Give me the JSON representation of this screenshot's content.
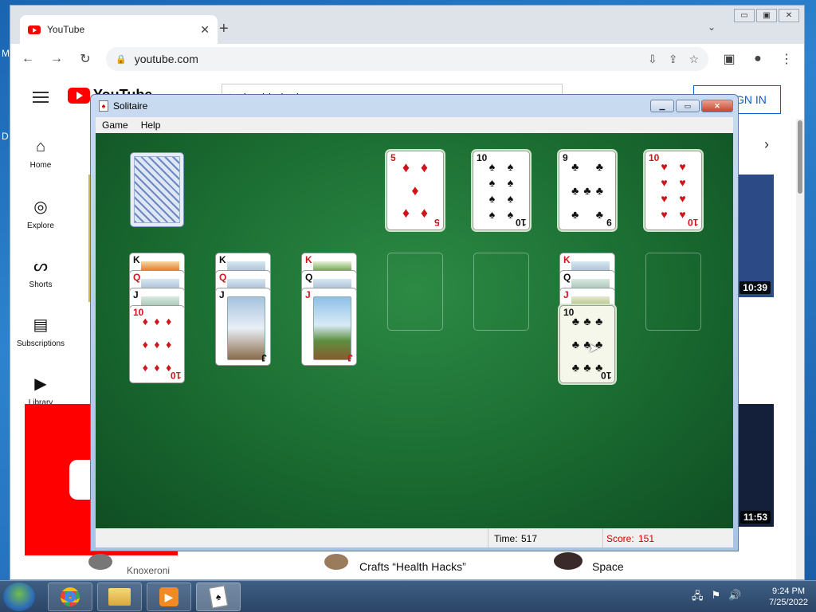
{
  "desktop": {
    "edge_letters": [
      "M",
      "D"
    ]
  },
  "browser": {
    "tab_title": "YouTube",
    "tab_close": "✕",
    "new_tab": "+",
    "tabs_menu": "⌄",
    "window_buttons": [
      "▭",
      "▣",
      "✕"
    ],
    "nav": {
      "back": "←",
      "forward": "→",
      "reload": "↻",
      "lock": "🔒"
    },
    "url": "youtube.com",
    "omnibox_icons": [
      "⇩",
      "⇪",
      "☆",
      "▣",
      "●",
      "⋮"
    ]
  },
  "youtube": {
    "logo_text": "YouTube",
    "search_value": "technoblade dog",
    "sign_in_label": "SIGN IN",
    "sidebar": [
      {
        "label": "Home",
        "icon": "⌂"
      },
      {
        "label": "Explore",
        "icon": "◎"
      },
      {
        "label": "Shorts",
        "icon": "ᔕ"
      },
      {
        "label": "Subscriptions",
        "icon": "▤"
      },
      {
        "label": "Library",
        "icon": "▶"
      }
    ],
    "durations": [
      "10:39",
      "11:53"
    ],
    "video_texts": [
      "Knoxeroni",
      "Crafts “Health Hacks”",
      "Space"
    ]
  },
  "solitaire": {
    "title": "Solitaire",
    "menu": [
      "Game",
      "Help"
    ],
    "status": {
      "time_label": "Time:",
      "time_value": "517",
      "score_label": "Score:",
      "score_value": "151"
    },
    "foundations": [
      {
        "rank": "5",
        "suit": "♦",
        "color": "red"
      },
      {
        "rank": "10",
        "suit": "♠",
        "color": "black"
      },
      {
        "rank": "9",
        "suit": "♣",
        "color": "black"
      },
      {
        "rank": "10",
        "suit": "♥",
        "color": "red"
      }
    ],
    "tableau": [
      {
        "cards": [
          {
            "rank": "K",
            "suit": "♣",
            "color": "black"
          },
          {
            "rank": "Q",
            "suit": "♥",
            "color": "red"
          },
          {
            "rank": "J",
            "suit": "♣",
            "color": "black"
          },
          {
            "rank": "10",
            "suit": "♦",
            "color": "red"
          }
        ]
      },
      {
        "cards": [
          {
            "rank": "K",
            "suit": "♠",
            "color": "black"
          },
          {
            "rank": "Q",
            "suit": "♥",
            "color": "red"
          },
          {
            "rank": "J",
            "suit": "♠",
            "color": "black"
          }
        ]
      },
      {
        "cards": [
          {
            "rank": "K",
            "suit": "♥",
            "color": "red"
          },
          {
            "rank": "Q",
            "suit": "♠",
            "color": "black"
          },
          {
            "rank": "J",
            "suit": "♥",
            "color": "red"
          }
        ]
      },
      {
        "cards": []
      },
      {
        "cards": []
      },
      {
        "cards": [
          {
            "rank": "K",
            "suit": "♦",
            "color": "red"
          },
          {
            "rank": "Q",
            "suit": "♣",
            "color": "black"
          },
          {
            "rank": "J",
            "suit": "♦",
            "color": "red"
          },
          {
            "rank": "10",
            "suit": "♣",
            "color": "black"
          }
        ]
      },
      {
        "cards": []
      }
    ]
  },
  "taskbar": {
    "apps": [
      "chrome",
      "explorer",
      "media-player",
      "solitaire"
    ],
    "time": "9:24 PM",
    "date": "7/25/2022"
  }
}
